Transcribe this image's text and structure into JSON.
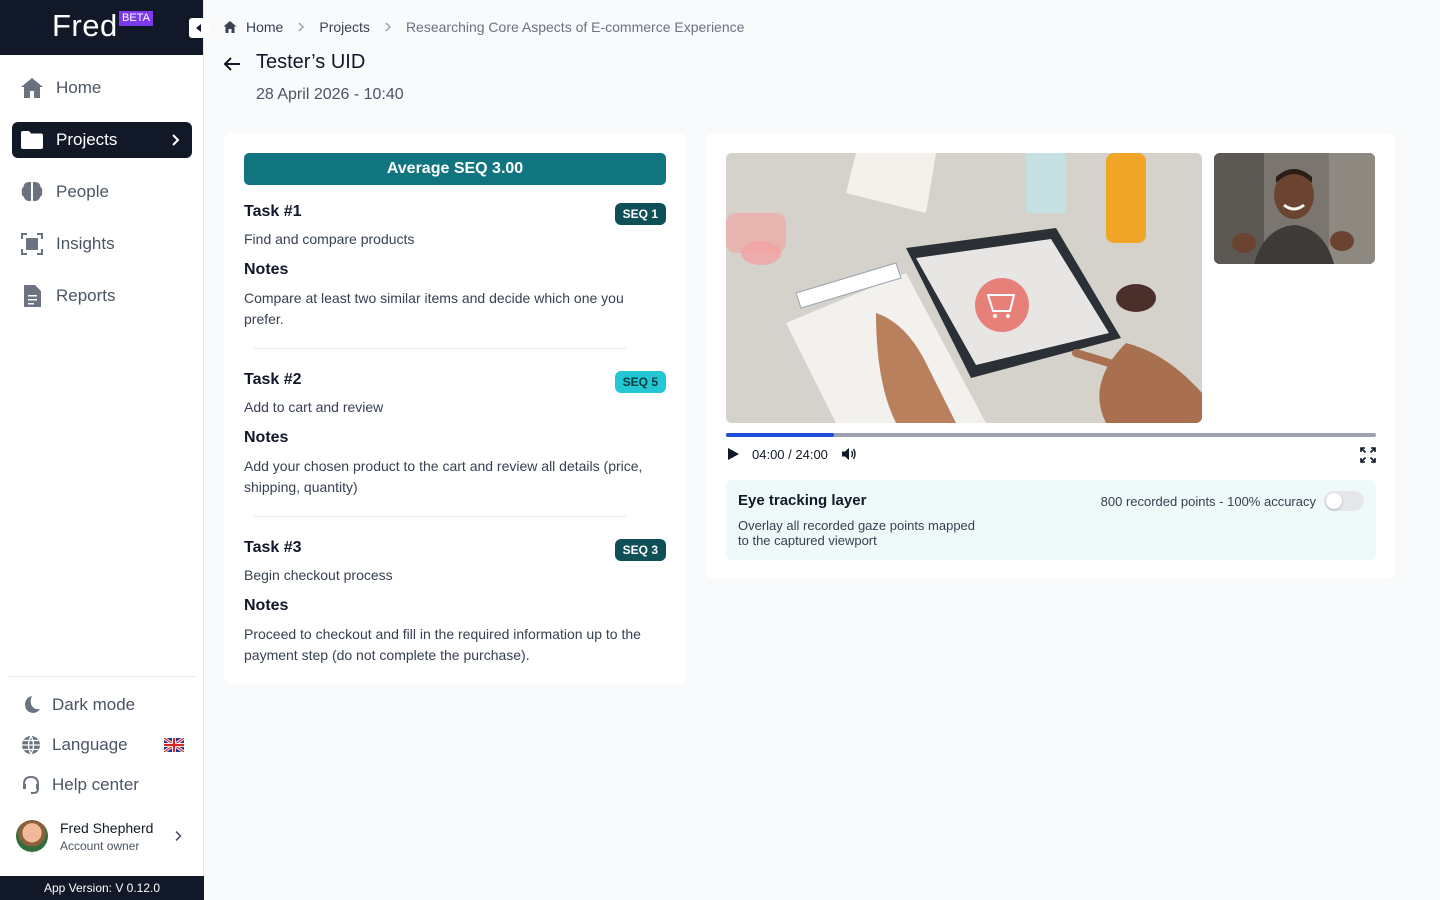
{
  "app": {
    "name": "Fred",
    "badge": "BETA",
    "version": "App Version: V 0.12.0"
  },
  "nav": [
    {
      "label": "Home",
      "icon": "home-icon",
      "active": false
    },
    {
      "label": "Projects",
      "icon": "folder-icon",
      "active": true
    },
    {
      "label": "People",
      "icon": "brain-icon",
      "active": false
    },
    {
      "label": "Insights",
      "icon": "insights-icon",
      "active": false
    },
    {
      "label": "Reports",
      "icon": "report-icon",
      "active": false
    }
  ],
  "utilities": {
    "dark_mode": "Dark mode",
    "language": "Language",
    "language_flag": "uk-flag-icon",
    "help": "Help center"
  },
  "user": {
    "name": "Fred Shepherd",
    "role": "Account owner"
  },
  "breadcrumb": [
    "Home",
    "Projects",
    "Researching Core Aspects of E-commerce Experience"
  ],
  "page": {
    "title": "Tester’s UID",
    "date": "28 April 2026 - 10:40"
  },
  "summary": {
    "average_seq": "Average SEQ 3.00"
  },
  "notes_heading": "Notes",
  "tasks": [
    {
      "title": "Task #1",
      "seq": "SEQ 1",
      "seq_style": "dark",
      "description": "Find and compare products",
      "notes": "Compare at least two similar items and decide which one you prefer."
    },
    {
      "title": "Task #2",
      "seq": "SEQ 5",
      "seq_style": "light",
      "description": "Add to cart and review",
      "notes": "Add your chosen product to the cart and review all details (price, shipping, quantity)"
    },
    {
      "title": "Task #3",
      "seq": "SEQ 3",
      "seq_style": "dark",
      "description": "Begin checkout process",
      "notes": "Proceed to checkout and fill in the required information up to the payment step (do not complete the purchase)."
    }
  ],
  "player": {
    "time": "04:00 / 24:00",
    "progress": 0.1667
  },
  "eye_tracking": {
    "title": "Eye tracking layer",
    "description": "Overlay all recorded gaze points mapped to the captured viewport",
    "stats": "800 recorded points - 100% accuracy",
    "enabled": false
  },
  "colors": {
    "sidebar_dark": "#111827",
    "accent_teal": "#117580",
    "seq_light": "#22c7d3",
    "progress": "#1d4ed8",
    "beta": "#7c3aed"
  }
}
